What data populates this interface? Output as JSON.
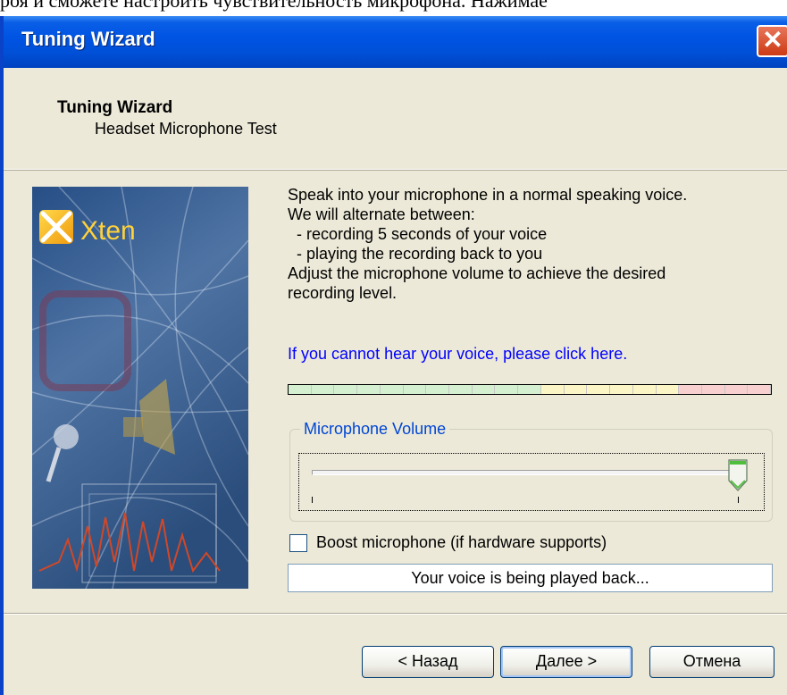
{
  "background": {
    "overflow_text": "роя и сможете настроить чувствительность микрофона. Нажимае"
  },
  "window": {
    "title": "Tuning Wizard",
    "close_glyph": "✕"
  },
  "header": {
    "title": "Tuning Wizard",
    "subtitle": "Headset Microphone Test"
  },
  "brand": {
    "logo_text": "Xten"
  },
  "instructions": [
    "Speak into your microphone in a normal speaking voice.",
    "We will alternate between:",
    "  - recording 5 seconds of your voice",
    "  - playing the recording back to you",
    "Adjust the microphone volume to achieve the desired",
    "recording level."
  ],
  "help_link": "If you cannot hear your voice, please click here.",
  "level_meter": {
    "segments": 21,
    "zones": [
      {
        "name": "low",
        "count": 11,
        "color": "#d4f0d0"
      },
      {
        "name": "mid",
        "count": 6,
        "color": "#fcf6c6"
      },
      {
        "name": "high",
        "count": 4,
        "color": "#f8d0d0"
      }
    ],
    "level": 0
  },
  "mic_volume": {
    "label": "Microphone Volume",
    "value": 1.0
  },
  "boost": {
    "label": "Boost microphone (if hardware supports)",
    "checked": false
  },
  "status_text": "Your voice is being played back...",
  "buttons": {
    "back": "< Назад",
    "next": "Далее >",
    "cancel": "Отмена"
  }
}
